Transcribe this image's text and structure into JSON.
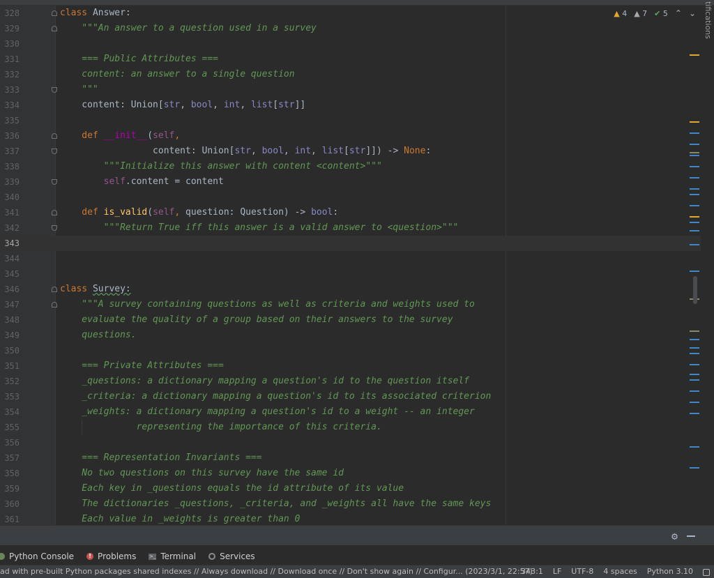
{
  "side_panel_label": "tifications",
  "inspections": {
    "warnings": "4",
    "weak_warnings": "7",
    "typos": "5"
  },
  "code_lines": [
    {
      "n": "328",
      "parts": [
        [
          "kw",
          "class "
        ],
        [
          "cls",
          "Answer:"
        ]
      ]
    },
    {
      "n": "329",
      "parts": [
        [
          "doc",
          "    \"\"\"An answer to a question used in a survey"
        ]
      ]
    },
    {
      "n": "330",
      "parts": []
    },
    {
      "n": "331",
      "parts": [
        [
          "doc",
          "    === Public Attributes ==="
        ]
      ]
    },
    {
      "n": "332",
      "parts": [
        [
          "doc",
          "    content: an answer to a single question"
        ]
      ]
    },
    {
      "n": "333",
      "parts": [
        [
          "doc",
          "    \"\"\""
        ]
      ]
    },
    {
      "n": "334",
      "parts": [
        [
          "",
          "    content: Union["
        ],
        [
          "bi",
          "str"
        ],
        [
          "",
          ", "
        ],
        [
          "bi",
          "bool"
        ],
        [
          "",
          ", "
        ],
        [
          "bi",
          "int"
        ],
        [
          "",
          ", "
        ],
        [
          "bi",
          "list"
        ],
        [
          "",
          "["
        ],
        [
          "bi",
          "str"
        ],
        [
          "",
          "]]"
        ]
      ]
    },
    {
      "n": "335",
      "parts": []
    },
    {
      "n": "336",
      "parts": [
        [
          "kw",
          "    def "
        ],
        [
          "magic",
          "__init__"
        ],
        [
          "",
          "("
        ],
        [
          "self",
          "self"
        ],
        [
          "kw",
          ","
        ]
      ]
    },
    {
      "n": "337",
      "parts": [
        [
          "",
          "                 content: Union["
        ],
        [
          "bi",
          "str"
        ],
        [
          "",
          ", "
        ],
        [
          "bi",
          "bool"
        ],
        [
          "",
          ", "
        ],
        [
          "bi",
          "int"
        ],
        [
          "",
          ", "
        ],
        [
          "bi",
          "list"
        ],
        [
          "",
          "["
        ],
        [
          "bi",
          "str"
        ],
        [
          "",
          "]]) -> "
        ],
        [
          "kw",
          "None"
        ],
        [
          "",
          ":"
        ]
      ]
    },
    {
      "n": "338",
      "parts": [
        [
          "doc",
          "        \"\"\"Initialize this answer with content <content>\"\"\""
        ]
      ]
    },
    {
      "n": "339",
      "parts": [
        [
          "self",
          "        self"
        ],
        [
          "",
          ".content = content"
        ]
      ]
    },
    {
      "n": "340",
      "parts": []
    },
    {
      "n": "341",
      "parts": [
        [
          "kw",
          "    def "
        ],
        [
          "fn",
          "is_valid"
        ],
        [
          "",
          "("
        ],
        [
          "self",
          "self"
        ],
        [
          "kw",
          ", "
        ],
        [
          "",
          "question: Question) -> "
        ],
        [
          "bi",
          "bool"
        ],
        [
          "",
          ":"
        ]
      ]
    },
    {
      "n": "342",
      "parts": [
        [
          "doc",
          "        \"\"\"Return True iff this answer is a valid answer to <question>\"\"\""
        ]
      ]
    },
    {
      "n": "343",
      "parts": []
    },
    {
      "n": "344",
      "parts": []
    },
    {
      "n": "345",
      "parts": []
    },
    {
      "n": "346",
      "parts": [
        [
          "kw",
          "class "
        ],
        [
          "squig",
          "Survey:"
        ]
      ]
    },
    {
      "n": "347",
      "parts": [
        [
          "doc",
          "    \"\"\"A survey containing questions as well as criteria and weights used to"
        ]
      ]
    },
    {
      "n": "348",
      "parts": [
        [
          "doc",
          "    evaluate the quality of a group based on their answers to the survey"
        ]
      ]
    },
    {
      "n": "349",
      "parts": [
        [
          "doc",
          "    questions."
        ]
      ]
    },
    {
      "n": "350",
      "parts": []
    },
    {
      "n": "351",
      "parts": [
        [
          "doc",
          "    === Private Attributes ==="
        ]
      ]
    },
    {
      "n": "352",
      "parts": [
        [
          "doc",
          "    _questions: a dictionary mapping a question's id to the question itself"
        ]
      ]
    },
    {
      "n": "353",
      "parts": [
        [
          "doc",
          "    _criteria: a dictionary mapping a question's id to its associated criterion"
        ]
      ]
    },
    {
      "n": "354",
      "parts": [
        [
          "doc",
          "    _weights: a dictionary mapping a question's id to a weight -- an integer"
        ]
      ]
    },
    {
      "n": "355",
      "parts": [
        [
          "doc",
          "              representing the importance of this criteria."
        ]
      ]
    },
    {
      "n": "356",
      "parts": []
    },
    {
      "n": "357",
      "parts": [
        [
          "doc",
          "    === Representation Invariants ==="
        ]
      ]
    },
    {
      "n": "358",
      "parts": [
        [
          "doc",
          "    No two questions on this survey have the same id"
        ]
      ]
    },
    {
      "n": "359",
      "parts": [
        [
          "doc",
          "    Each key in _questions equals the id attribute of its value"
        ]
      ]
    },
    {
      "n": "360",
      "parts": [
        [
          "doc",
          "    The dictionaries _questions, _criteria, and _weights all have the same keys"
        ]
      ]
    },
    {
      "n": "361",
      "parts": [
        [
          "doc",
          "    Each value in _weights is greater than 0"
        ]
      ]
    }
  ],
  "tool_tabs": [
    {
      "label": "Python Console",
      "icon": "python-icon"
    },
    {
      "label": "Problems",
      "icon": "problems-icon"
    },
    {
      "label": "Terminal",
      "icon": "terminal-icon"
    },
    {
      "label": "Services",
      "icon": "services-icon"
    }
  ],
  "status": {
    "message": "ad with pre-built Python packages shared indexes // Always download // Download once // Don't show again // Configur... (2023/3/1, 22:57)",
    "cursor": "343:1",
    "line_sep": "LF",
    "encoding": "UTF-8",
    "indent": "4 spaces",
    "interpreter": "Python 3.10"
  },
  "colors": {
    "keyword": "#cc7832",
    "docstring": "#629755",
    "builtin": "#8888c6",
    "self": "#94558d",
    "function": "#ffc66d",
    "warning": "#e0a82e",
    "info_marker": "#3e86c9"
  }
}
